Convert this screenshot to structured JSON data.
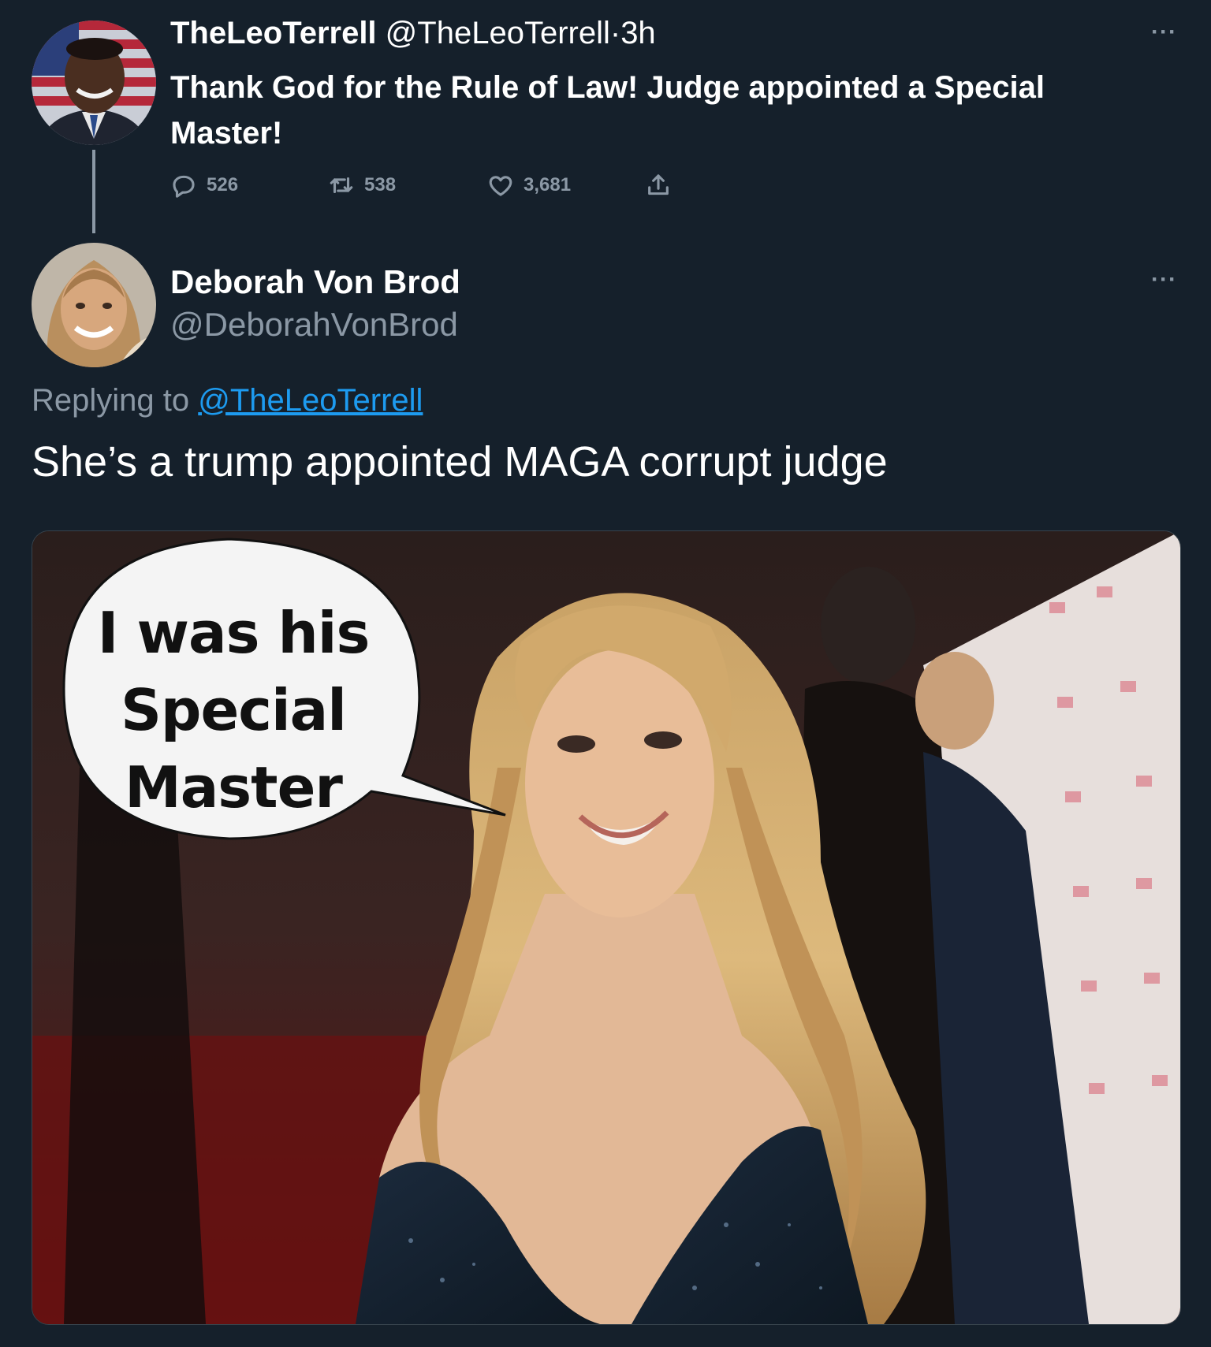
{
  "original_tweet": {
    "display_name": "TheLeoTerrell",
    "handle": "@TheLeoTerrell",
    "separator": "·",
    "time": "3h",
    "text": "Thank God for the Rule of Law! Judge appointed a Special Master!",
    "more_label": "···",
    "stats": {
      "replies": "526",
      "retweets": "538",
      "likes": "3,681"
    },
    "icons": {
      "reply": "reply-icon",
      "retweet": "retweet-icon",
      "like": "heart-icon",
      "share": "share-icon"
    }
  },
  "reply_tweet": {
    "display_name": "Deborah Von Brod",
    "handle": "@DeborahVonBrod",
    "more_label": "···",
    "replying_prefix": "Replying to",
    "replying_mention": "@TheLeoTerrell",
    "text": "She’s a trump appointed MAGA corrupt judge",
    "media": {
      "bubble_text_line1": "I was his",
      "bubble_text_line2": "Special",
      "bubble_text_line3": "Master"
    }
  },
  "colors": {
    "background": "#15202b",
    "secondary_text": "#8b98a5",
    "link": "#1d9bf0"
  }
}
